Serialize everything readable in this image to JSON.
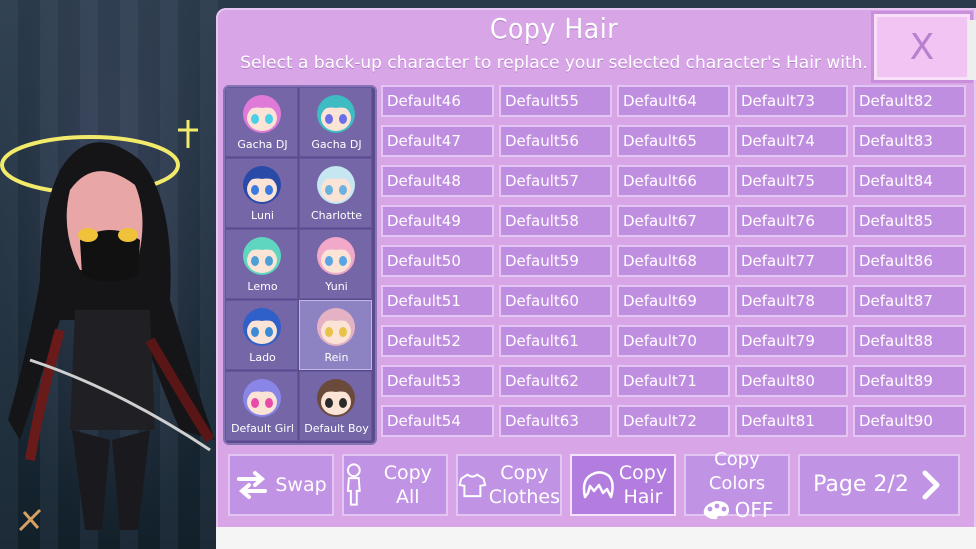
{
  "panel": {
    "title": "Copy Hair",
    "subtitle": "Select a back-up character to replace your selected character's Hair with.",
    "close_label": "X"
  },
  "characters": [
    {
      "name": "Gacha DJ",
      "hair": "#e07ad8",
      "eyes": "#4ad0e6"
    },
    {
      "name": "Gacha DJ",
      "hair": "#3fbbc4",
      "eyes": "#6a6ee8"
    },
    {
      "name": "Luni",
      "hair": "#2a4aa8",
      "eyes": "#3b7ae0"
    },
    {
      "name": "Charlotte",
      "hair": "#c6e6f2",
      "eyes": "#6ab2e0"
    },
    {
      "name": "Lemo",
      "hair": "#5ed6c0",
      "eyes": "#4ba0d8"
    },
    {
      "name": "Yuni",
      "hair": "#f2a8c8",
      "eyes": "#5aa4e6"
    },
    {
      "name": "Lado",
      "hair": "#2f5fc8",
      "eyes": "#3a8ad8"
    },
    {
      "name": "Rein",
      "hair": "#e4b2c4",
      "eyes": "#e8c34a",
      "selected": true
    },
    {
      "name": "Default Girl",
      "hair": "#8a86e8",
      "eyes": "#ea4aa8"
    },
    {
      "name": "Default Boy",
      "hair": "#6a4a3a",
      "eyes": "#2a2a2a"
    }
  ],
  "grid": {
    "columns": [
      [
        "Default46",
        "Default47",
        "Default48",
        "Default49",
        "Default50",
        "Default51",
        "Default52",
        "Default53",
        "Default54"
      ],
      [
        "Default55",
        "Default56",
        "Default57",
        "Default58",
        "Default59",
        "Default60",
        "Default61",
        "Default62",
        "Default63"
      ],
      [
        "Default64",
        "Default65",
        "Default66",
        "Default67",
        "Default68",
        "Default69",
        "Default70",
        "Default71",
        "Default72"
      ],
      [
        "Default73",
        "Default74",
        "Default75",
        "Default76",
        "Default77",
        "Default78",
        "Default79",
        "Default80",
        "Default81"
      ],
      [
        "Default82",
        "Default83",
        "Default84",
        "Default85",
        "Default86",
        "Default87",
        "Default88",
        "Default89",
        "Default90"
      ]
    ]
  },
  "toolbar": {
    "swap": "Swap",
    "copy_all": "Copy All",
    "copy_clothes_1": "Copy",
    "copy_clothes_2": "Clothes",
    "copy_hair_1": "Copy",
    "copy_hair_2": "Hair",
    "copy_colors": "Copy Colors",
    "colors_state": "OFF",
    "page": "Page 2/2"
  },
  "colors": {
    "panel": "#d8a6e6",
    "cell": "#c08ee0",
    "cell_border": "#e3c5f3",
    "character_panel": "#5b4b8a"
  }
}
